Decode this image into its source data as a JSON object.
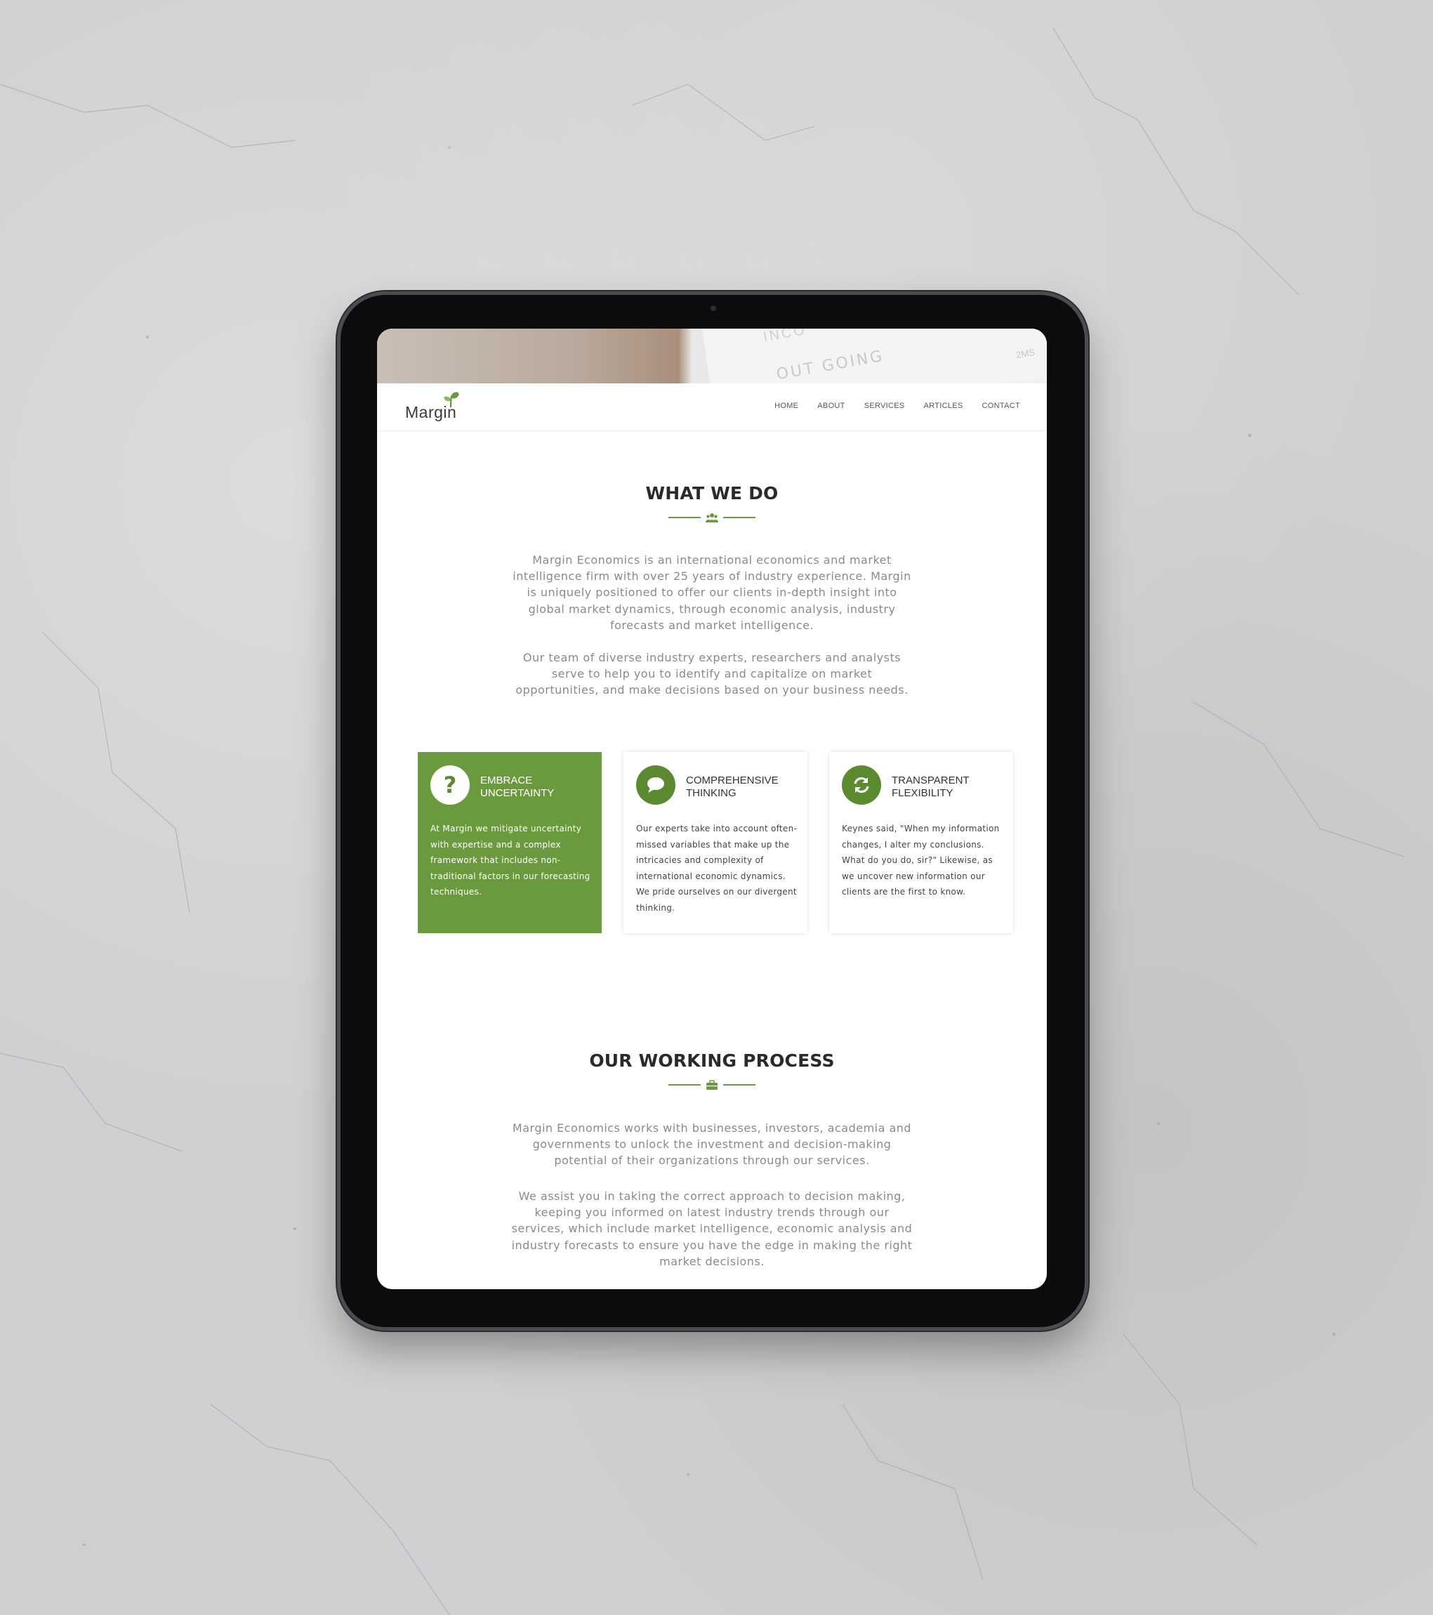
{
  "hero": {
    "text_primary": "OUT GOING",
    "text_secondary": "INCO",
    "text_corner": "2MS"
  },
  "nav": {
    "logo_text": "Margin",
    "items": [
      {
        "label": "HOME"
      },
      {
        "label": "ABOUT"
      },
      {
        "label": "SERVICES"
      },
      {
        "label": "ARTICLES"
      },
      {
        "label": "CONTACT"
      }
    ]
  },
  "what_we_do": {
    "title": "WHAT WE DO",
    "divider_icon": "people-group-icon",
    "paragraph1": "Margin Economics is an international economics and market intelligence firm with over 25 years of industry experience. Margin is uniquely positioned to offer our clients in-depth insight into global market dynamics, through economic analysis, industry forecasts and market intelligence.",
    "paragraph2": "Our team of diverse industry experts, researchers and analysts serve to help you to identify and capitalize on market opportunities, and make decisions based on your business needs."
  },
  "cards": [
    {
      "icon": "question-icon",
      "title": "EMBRACE UNCERTAINTY",
      "text": "At Margin we mitigate uncertainty with expertise and a complex framework that includes non-traditional factors in our forecasting techniques."
    },
    {
      "icon": "chat-bubble-icon",
      "title": "COMPREHENSIVE THINKING",
      "text": "Our experts take into account often-missed variables that make up the intricacies and complexity of international economic dynamics. We pride ourselves on our divergent thinking."
    },
    {
      "icon": "refresh-icon",
      "title": "TRANSPARENT FLEXIBILITY",
      "text": "Keynes said, \"When my information changes, I alter my conclusions. What do you do, sir?\" Likewise, as we uncover new information our clients are the first to know."
    }
  ],
  "working_process": {
    "title": "OUR WORKING PROCESS",
    "divider_icon": "briefcase-icon",
    "paragraph1": "Margin Economics works with businesses, investors, academia and governments to unlock the investment and decision-making potential of their organizations through our services.",
    "paragraph2": "We assist you in taking the correct approach to decision making, keeping you informed on latest industry trends through our services, which include market intelligence, economic analysis and industry forecasts to ensure you have the edge in making the right market decisions."
  },
  "colors": {
    "accent_green": "#6b9a3e",
    "icon_green": "#5b8a31",
    "background_concrete": "#cfd0d1",
    "tablet_frame": "#0b0c0d"
  }
}
